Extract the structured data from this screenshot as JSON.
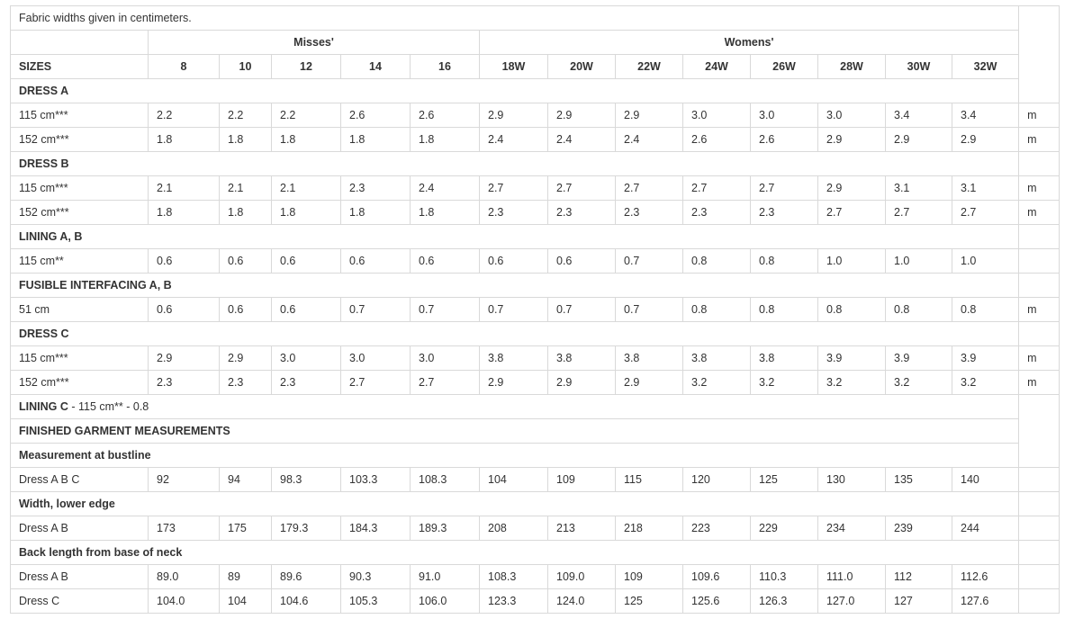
{
  "note": "Fabric widths given in centimeters.",
  "group_misses": "Misses'",
  "group_womens": "Womens'",
  "sizes_label": "SIZES",
  "sizes": [
    "8",
    "10",
    "12",
    "14",
    "16",
    "18W",
    "20W",
    "22W",
    "24W",
    "26W",
    "28W",
    "30W",
    "32W"
  ],
  "rows": [
    {
      "kind": "section",
      "label": "DRESS A"
    },
    {
      "kind": "data",
      "label": "115 cm***",
      "values": [
        "2.2",
        "2.2",
        "2.2",
        "2.6",
        "2.6",
        "2.9",
        "2.9",
        "2.9",
        "3.0",
        "3.0",
        "3.0",
        "3.4",
        "3.4"
      ],
      "unit": "m"
    },
    {
      "kind": "data",
      "label": "152 cm***",
      "values": [
        "1.8",
        "1.8",
        "1.8",
        "1.8",
        "1.8",
        "2.4",
        "2.4",
        "2.4",
        "2.6",
        "2.6",
        "2.9",
        "2.9",
        "2.9"
      ],
      "unit": "m"
    },
    {
      "kind": "section",
      "label": "DRESS B"
    },
    {
      "kind": "data",
      "label": "115 cm***",
      "values": [
        "2.1",
        "2.1",
        "2.1",
        "2.3",
        "2.4",
        "2.7",
        "2.7",
        "2.7",
        "2.7",
        "2.7",
        "2.9",
        "3.1",
        "3.1"
      ],
      "unit": "m"
    },
    {
      "kind": "data",
      "label": "152 cm***",
      "values": [
        "1.8",
        "1.8",
        "1.8",
        "1.8",
        "1.8",
        "2.3",
        "2.3",
        "2.3",
        "2.3",
        "2.3",
        "2.7",
        "2.7",
        "2.7"
      ],
      "unit": "m"
    },
    {
      "kind": "section",
      "label": "LINING A, B"
    },
    {
      "kind": "data",
      "label": "115 cm**",
      "values": [
        "0.6",
        "0.6",
        "0.6",
        "0.6",
        "0.6",
        "0.6",
        "0.6",
        "0.7",
        "0.8",
        "0.8",
        "1.0",
        "1.0",
        "1.0"
      ],
      "unit": ""
    },
    {
      "kind": "section",
      "label": "FUSIBLE INTERFACING A, B"
    },
    {
      "kind": "data",
      "label": "51 cm",
      "values": [
        "0.6",
        "0.6",
        "0.6",
        "0.7",
        "0.7",
        "0.7",
        "0.7",
        "0.7",
        "0.8",
        "0.8",
        "0.8",
        "0.8",
        "0.8"
      ],
      "unit": "m"
    },
    {
      "kind": "section",
      "label": "DRESS C"
    },
    {
      "kind": "data",
      "label": "115 cm***",
      "values": [
        "2.9",
        "2.9",
        "3.0",
        "3.0",
        "3.0",
        "3.8",
        "3.8",
        "3.8",
        "3.8",
        "3.8",
        "3.9",
        "3.9",
        "3.9"
      ],
      "unit": "m"
    },
    {
      "kind": "data",
      "label": "152 cm***",
      "values": [
        "2.3",
        "2.3",
        "2.3",
        "2.7",
        "2.7",
        "2.9",
        "2.9",
        "2.9",
        "3.2",
        "3.2",
        "3.2",
        "3.2",
        "3.2"
      ],
      "unit": "m"
    },
    {
      "kind": "section",
      "label": "LINING C",
      "suffix": " - 115 cm** - 0.8"
    },
    {
      "kind": "section",
      "label": "FINISHED GARMENT MEASUREMENTS"
    },
    {
      "kind": "section",
      "label": "Measurement at bustline"
    },
    {
      "kind": "data",
      "label": "Dress A B C",
      "values": [
        "92",
        "94",
        "98.3",
        "103.3",
        "108.3",
        "104",
        "109",
        "115",
        "120",
        "125",
        "130",
        "135",
        "140"
      ],
      "unit": ""
    },
    {
      "kind": "section",
      "label": "Width, lower edge"
    },
    {
      "kind": "data",
      "label": "Dress A B",
      "values": [
        "173",
        "175",
        "179.3",
        "184.3",
        "189.3",
        "208",
        "213",
        "218",
        "223",
        "229",
        "234",
        "239",
        "244"
      ],
      "unit": ""
    },
    {
      "kind": "section",
      "label": "Back length from base of neck"
    },
    {
      "kind": "data",
      "label": "Dress A B",
      "values": [
        "89.0",
        "89",
        "89.6",
        "90.3",
        "91.0",
        "108.3",
        "109.0",
        "109",
        "109.6",
        "110.3",
        "111.0",
        "112",
        "112.6"
      ],
      "unit": ""
    },
    {
      "kind": "data",
      "label": "Dress C",
      "values": [
        "104.0",
        "104",
        "104.6",
        "105.3",
        "106.0",
        "123.3",
        "124.0",
        "125",
        "125.6",
        "126.3",
        "127.0",
        "127",
        "127.6"
      ],
      "unit": ""
    }
  ]
}
